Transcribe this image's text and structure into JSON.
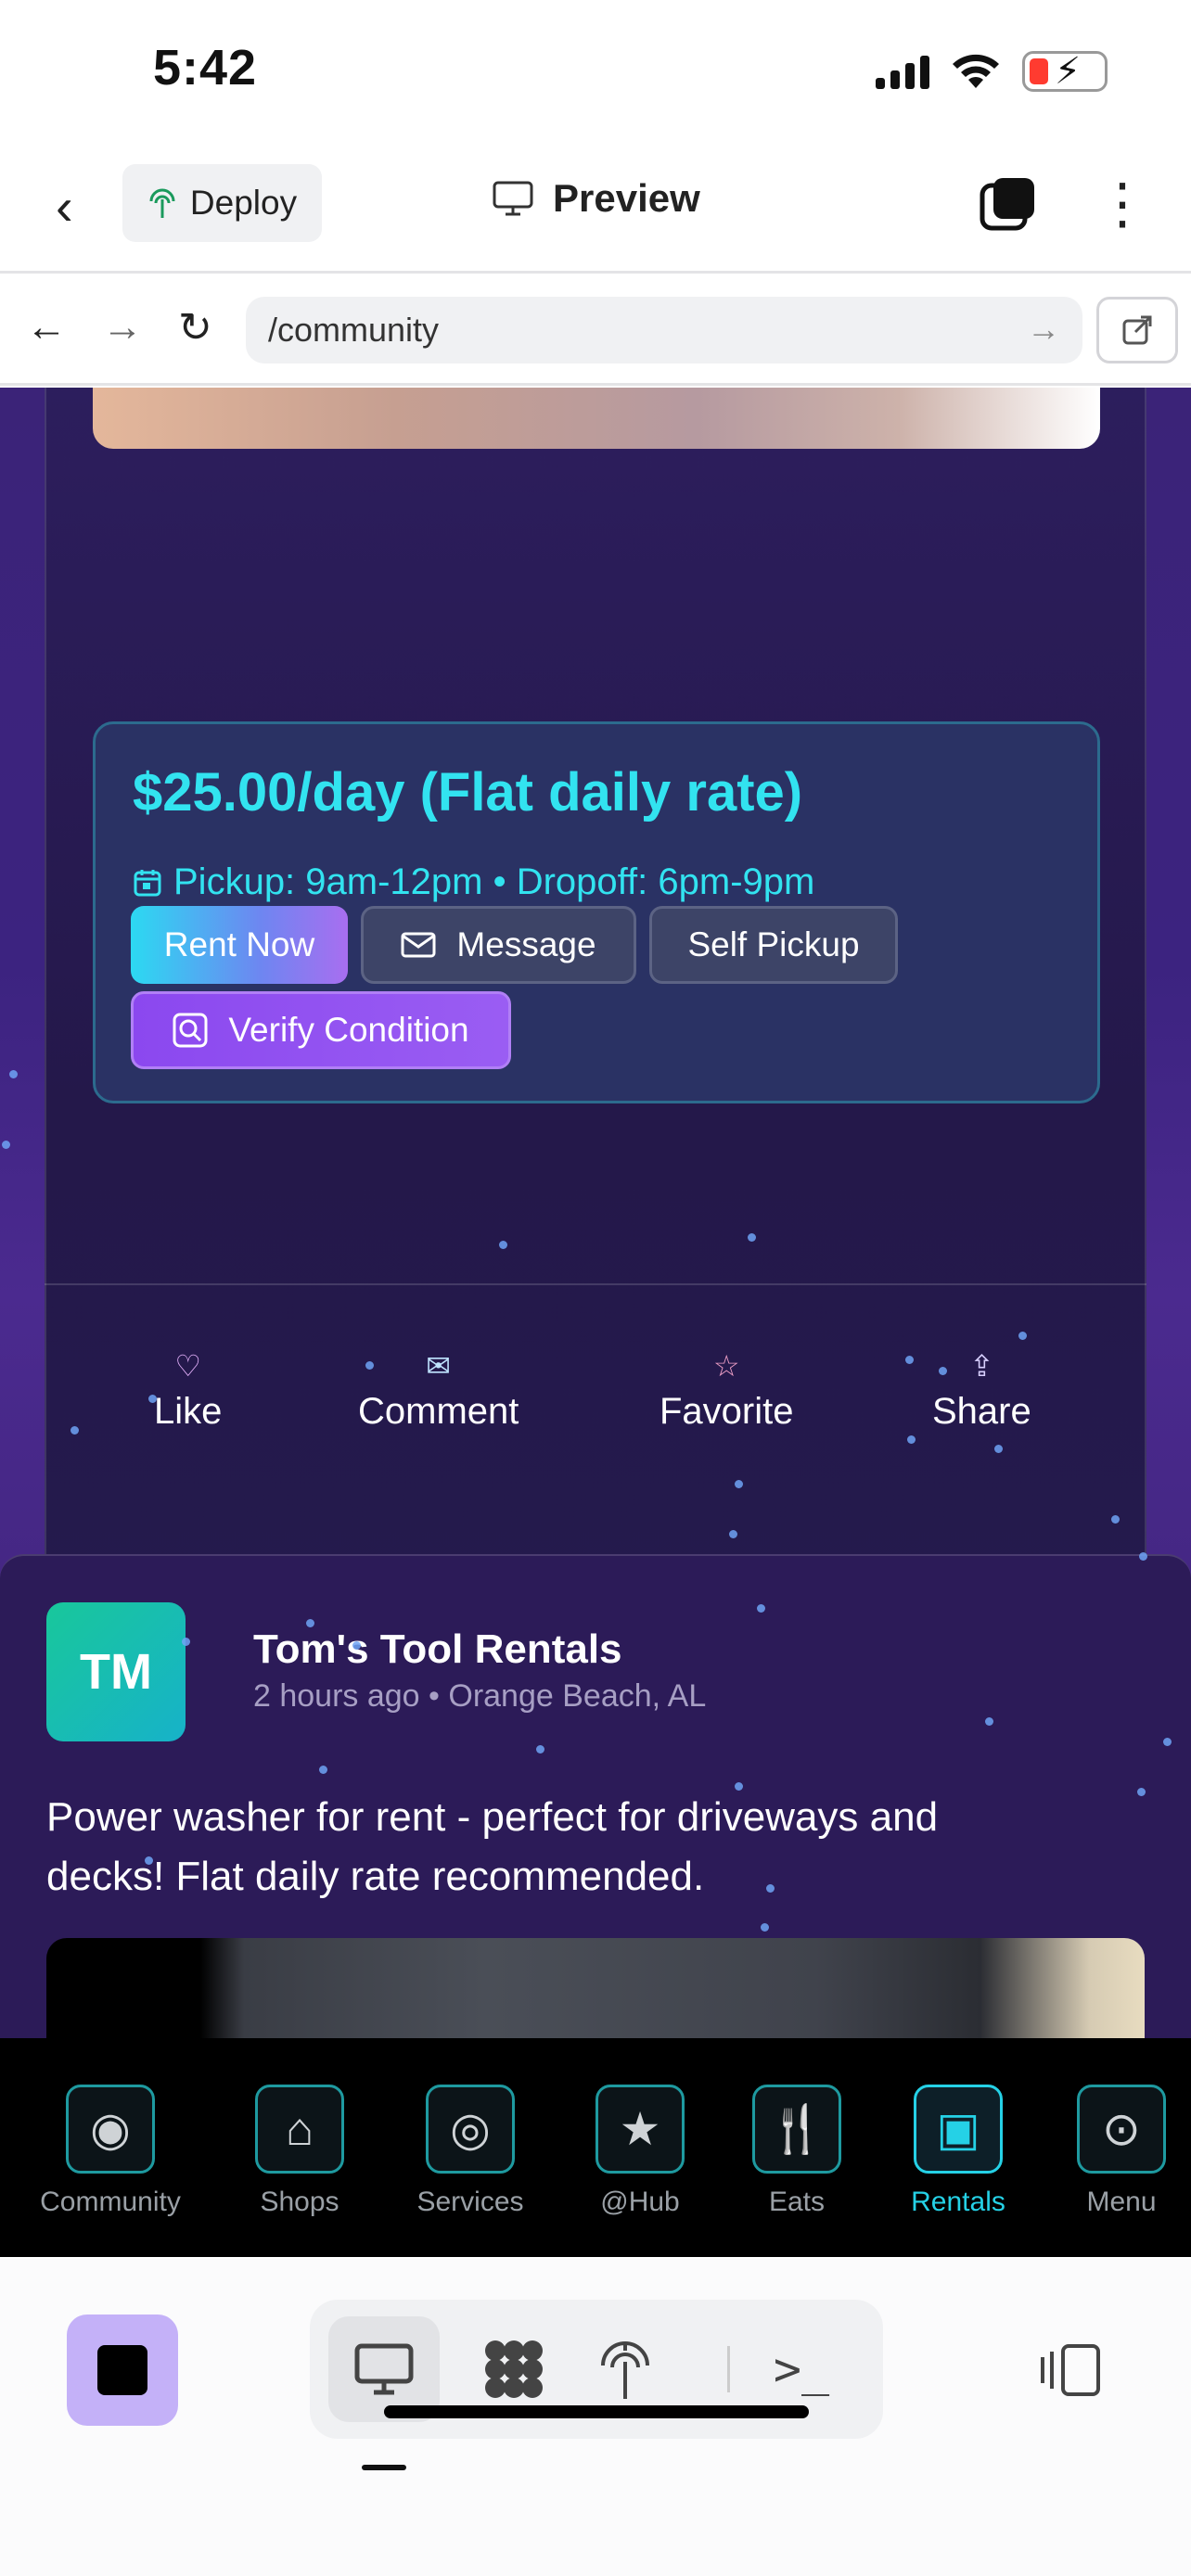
{
  "status": {
    "time": "5:42"
  },
  "topbar": {
    "deploy_label": "Deploy",
    "preview_label": "Preview"
  },
  "browser": {
    "url": "/community"
  },
  "listing": {
    "price": "$25.00/day (Flat daily rate)",
    "schedule": "Pickup: 9am-12pm • Dropoff: 6pm-9pm",
    "buttons": {
      "rent": "Rent Now",
      "message": "Message",
      "self_pickup": "Self Pickup",
      "verify": "Verify Condition"
    }
  },
  "actions": {
    "like": "Like",
    "comment": "Comment",
    "favorite": "Favorite",
    "share": "Share"
  },
  "post": {
    "avatar_initials": "TM",
    "author": "Tom's Tool Rentals",
    "meta": "2 hours ago • Orange Beach, AL",
    "text": "Power washer for rent - perfect for driveways and decks! Flat daily rate recommended."
  },
  "tabs": [
    {
      "label": "Community",
      "icon": "community-icon"
    },
    {
      "label": "Shops",
      "icon": "shop-icon"
    },
    {
      "label": "Services",
      "icon": "services-icon"
    },
    {
      "label": "@Hub",
      "icon": "star-icon"
    },
    {
      "label": "Eats",
      "icon": "utensils-icon"
    },
    {
      "label": "Rentals",
      "icon": "rentals-icon",
      "active": true
    },
    {
      "label": "Menu",
      "icon": "menu-icon"
    }
  ],
  "colors": {
    "accent_cyan": "#32e3f0",
    "accent_purple": "#9a5df3",
    "background_purple": "#3c2380"
  }
}
